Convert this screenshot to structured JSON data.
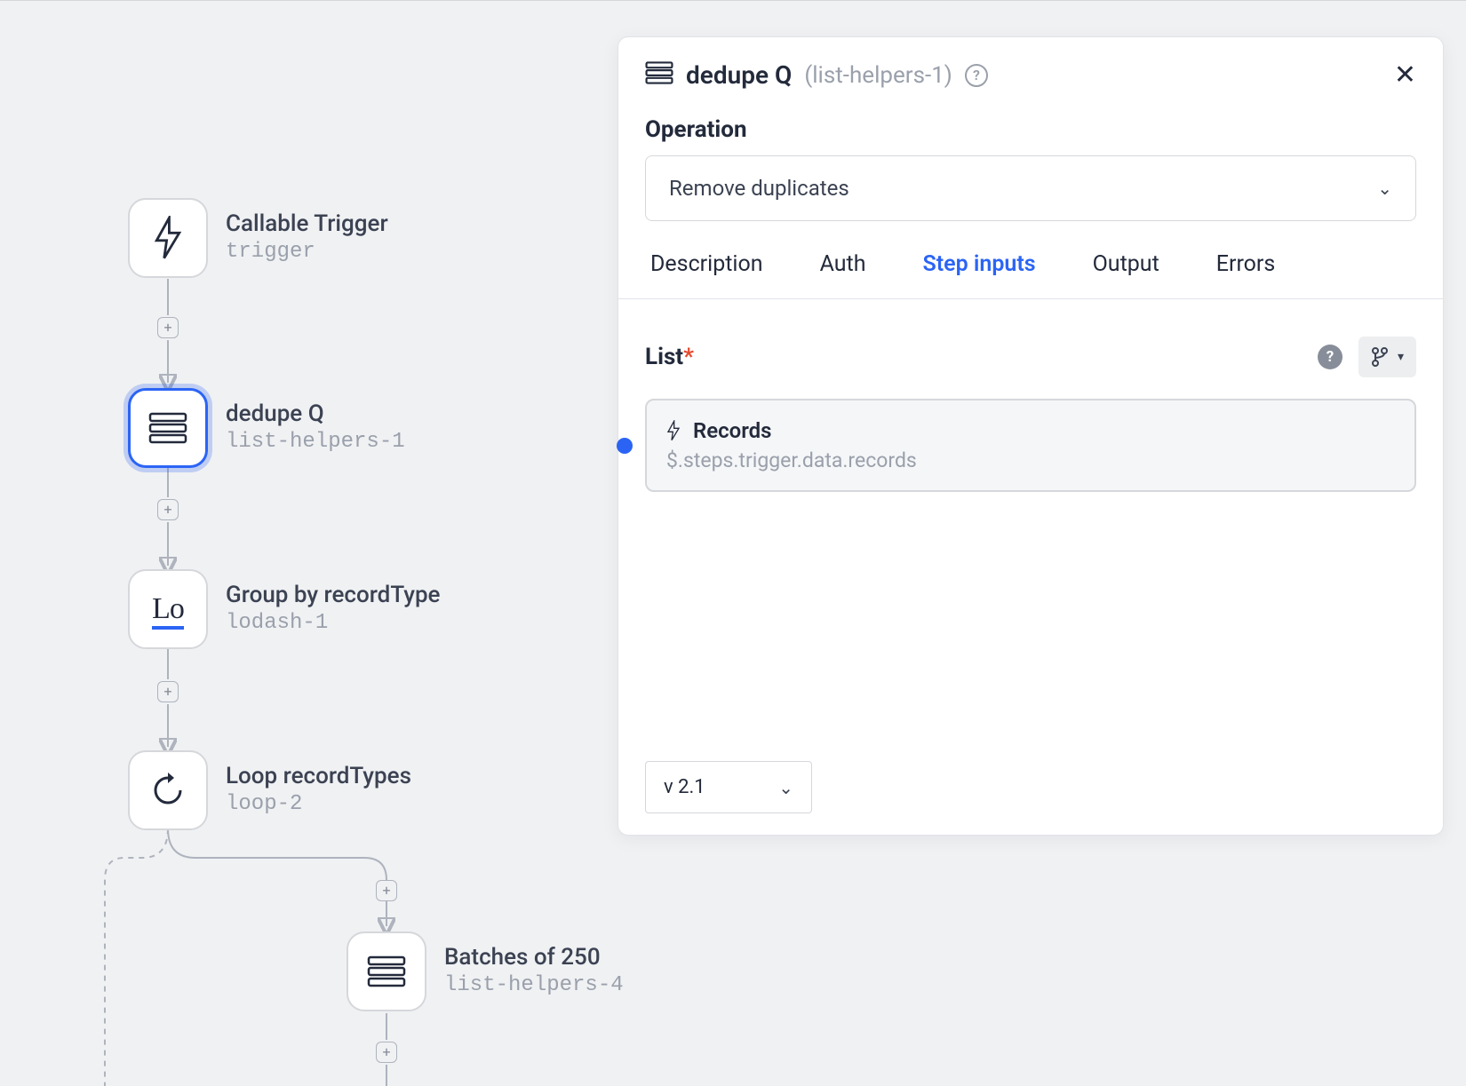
{
  "workflow": {
    "nodes": [
      {
        "title": "Callable Trigger",
        "sub": "trigger",
        "icon": "bolt"
      },
      {
        "title": "dedupe Q",
        "sub": "list-helpers-1",
        "icon": "list",
        "selected": true
      },
      {
        "title": "Group by recordType",
        "sub": "lodash-1",
        "icon": "lo"
      },
      {
        "title": "Loop recordTypes",
        "sub": "loop-2",
        "icon": "loop"
      },
      {
        "title": "Batches of 250",
        "sub": "list-helpers-4",
        "icon": "list"
      }
    ]
  },
  "panel": {
    "title": "dedupe Q",
    "subtitle": "(list-helpers-1)",
    "operation_label": "Operation",
    "operation_value": "Remove duplicates",
    "tabs": [
      "Description",
      "Auth",
      "Step inputs",
      "Output",
      "Errors"
    ],
    "active_tab": "Step inputs",
    "field_label": "List",
    "value_title": "Records",
    "value_path": "$.steps.trigger.data.records",
    "version": "v 2.1"
  }
}
